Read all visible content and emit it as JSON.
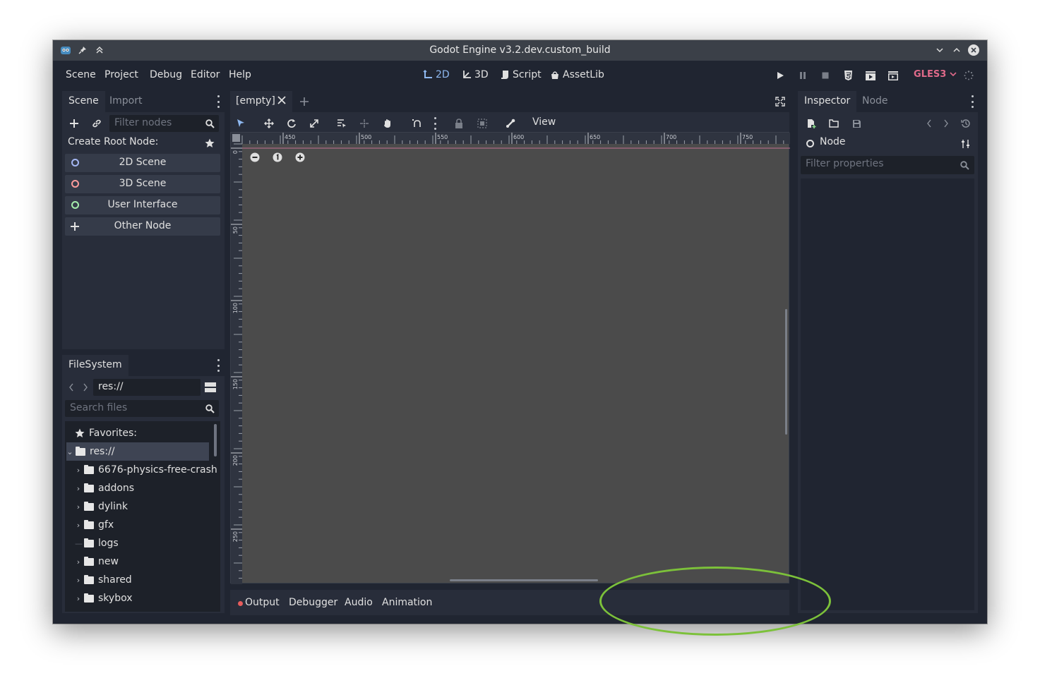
{
  "window": {
    "title": "Godot Engine v3.2.dev.custom_build"
  },
  "menu": {
    "scene": "Scene",
    "project": "Project",
    "debug": "Debug",
    "editor": "Editor",
    "help": "Help"
  },
  "workspaces": {
    "w2d": "2D",
    "w3d": "3D",
    "script": "Script",
    "assetlib": "AssetLib"
  },
  "renderer": "GLES3",
  "scene_dock": {
    "tabs": {
      "scene": "Scene",
      "import": "Import"
    },
    "filter_placeholder": "Filter nodes",
    "create_root_label": "Create Root Node:",
    "root_buttons": {
      "scene2d": "2D Scene",
      "scene3d": "3D Scene",
      "ui": "User Interface",
      "other": "Other Node"
    }
  },
  "filesystem": {
    "tab": "FileSystem",
    "path": "res://",
    "search_placeholder": "Search files",
    "favorites": "Favorites:",
    "root": "res://",
    "folders": [
      "6676-physics-free-crash",
      "addons",
      "dylink",
      "gfx",
      "logs",
      "new",
      "shared",
      "skybox"
    ]
  },
  "editor": {
    "scene_tab": "[empty]",
    "view_menu": "View",
    "ruler_x": [
      "450",
      "500",
      "550",
      "600",
      "650",
      "700",
      "750"
    ],
    "ruler_y": [
      "0",
      "50",
      "100",
      "150",
      "200",
      "250"
    ]
  },
  "bottom_panel": {
    "output": "Output",
    "debugger": "Debugger",
    "audio": "Audio",
    "animation": "Animation"
  },
  "inspector": {
    "tabs": {
      "inspector": "Inspector",
      "node": "Node"
    },
    "node_label": "Node",
    "filter_placeholder": "Filter properties"
  },
  "colors": {
    "accent": "#8eb8f0",
    "annotation": "#7cc13a",
    "renderer": "#e06a8a"
  }
}
